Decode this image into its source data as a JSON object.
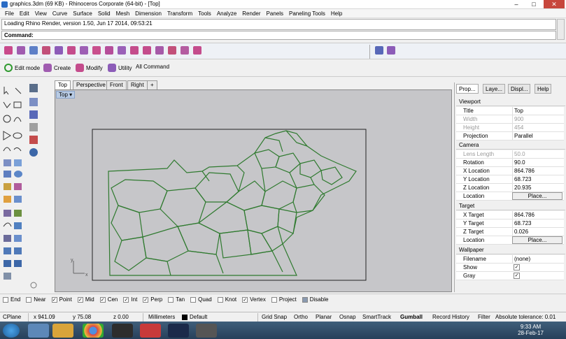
{
  "window": {
    "title": "graphics.3dm (69 KB) - Rhinoceros Corporate (64-bit) - [Top]"
  },
  "menu": [
    "File",
    "Edit",
    "View",
    "Curve",
    "Surface",
    "Solid",
    "Mesh",
    "Dimension",
    "Transform",
    "Tools",
    "Analyze",
    "Render",
    "Panels",
    "Paneling Tools",
    "Help"
  ],
  "command": {
    "history": "Loading Rhino Render, version 1.50, Jun 17 2014, 09:53:21",
    "prompt": "Command:"
  },
  "toolbar2": {
    "edit_mode": "Edit mode",
    "create": "Create",
    "modify": "Modify",
    "utility": "Utility",
    "all_command": "All Command"
  },
  "viewport_tabs": [
    "Top",
    "Perspective",
    "Front",
    "Right",
    "+"
  ],
  "viewport": {
    "label": "Top",
    "axis_x": "x",
    "axis_y": "y"
  },
  "right_panel": {
    "tabs": [
      "Prop...",
      "Laye...",
      "Displ...",
      "Help"
    ],
    "sections": {
      "viewport": "Viewport",
      "camera": "Camera",
      "target": "Target",
      "wallpaper": "Wallpaper"
    },
    "viewport_rows": [
      {
        "key": "Title",
        "value": "Top"
      },
      {
        "key": "Width",
        "value": "900"
      },
      {
        "key": "Height",
        "value": "454"
      },
      {
        "key": "Projection",
        "value": "Parallel"
      }
    ],
    "camera_rows": [
      {
        "key": "Lens Length",
        "value": "50.0"
      },
      {
        "key": "Rotation",
        "value": "90.0"
      },
      {
        "key": "X Location",
        "value": "864.786"
      },
      {
        "key": "Y Location",
        "value": "68.723"
      },
      {
        "key": "Z Location",
        "value": "20.935"
      },
      {
        "key": "Location",
        "value": "Place..."
      }
    ],
    "target_rows": [
      {
        "key": "X Target",
        "value": "864.786"
      },
      {
        "key": "Y Target",
        "value": "68.723"
      },
      {
        "key": "Z Target",
        "value": "0.026"
      },
      {
        "key": "Location",
        "value": "Place..."
      }
    ],
    "wallpaper_rows": [
      {
        "key": "Filename",
        "value": "(none)"
      },
      {
        "key": "Show",
        "value": "✓"
      },
      {
        "key": "Gray",
        "value": "✓"
      }
    ]
  },
  "osnaps": [
    {
      "label": "End",
      "checked": false
    },
    {
      "label": "Near",
      "checked": false
    },
    {
      "label": "Point",
      "checked": true
    },
    {
      "label": "Mid",
      "checked": true
    },
    {
      "label": "Cen",
      "checked": true
    },
    {
      "label": "Int",
      "checked": true
    },
    {
      "label": "Perp",
      "checked": true
    },
    {
      "label": "Tan",
      "checked": false
    },
    {
      "label": "Quad",
      "checked": false
    },
    {
      "label": "Knot",
      "checked": false
    },
    {
      "label": "Vertex",
      "checked": true
    },
    {
      "label": "Project",
      "checked": false
    },
    {
      "label": "Disable",
      "checked": false
    }
  ],
  "status": {
    "cplane": "CPlane",
    "x": "x 941.09",
    "y": "y 75.08",
    "z": "z 0.00",
    "units": "Millimeters",
    "layer": "Default",
    "grid_snap": "Grid Snap",
    "ortho": "Ortho",
    "planar": "Planar",
    "osnap": "Osnap",
    "smarttrack": "SmartTrack",
    "gumball": "Gumball",
    "record_history": "Record History",
    "filter": "Filter",
    "tolerance": "Absolute tolerance: 0.01"
  },
  "taskbar": {
    "time": "9:33 AM",
    "date": "28-Feb-17"
  },
  "colors": {
    "geometry": "#2f7a2f",
    "viewport_bg": "#c6c6c9",
    "accent": "#2b6cc4"
  }
}
